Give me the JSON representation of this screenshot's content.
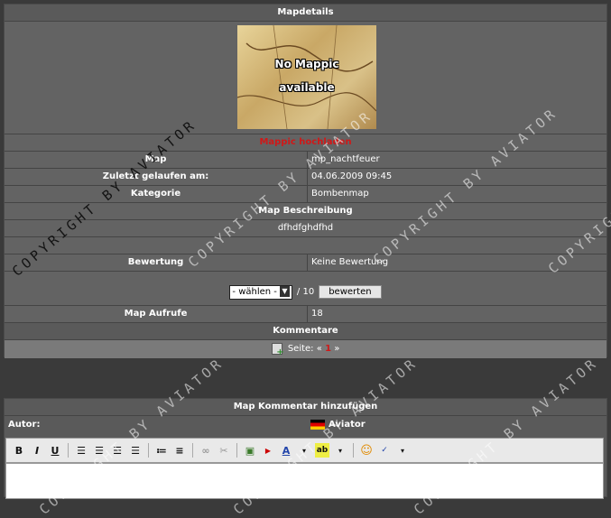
{
  "mapdetails": {
    "header": "Mapdetails",
    "mappic_line1": "No Mappic",
    "mappic_line2": "available",
    "upload_link": "Mappic hochladen",
    "rows": [
      {
        "label": "Map",
        "value": "mp_nachtfeuer"
      },
      {
        "label": "Zuletzt gelaufen am:",
        "value": "04.06.2009 09:45"
      },
      {
        "label": "Kategorie",
        "value": "Bombenmap"
      }
    ],
    "description_header": "Map Beschreibung",
    "description": "dfhdfghdfhd",
    "rating_label": "Bewertung",
    "rating_value": "Keine Bewertung",
    "rating_select": "- wählen -",
    "rating_max": "/ 10",
    "rate_button": "bewerten",
    "views_label": "Map Aufrufe",
    "views_value": "18",
    "comments_header": "Kommentare",
    "page_label": "Seite:",
    "page_prev": "«",
    "page_current": "1",
    "page_next": "»"
  },
  "comment_form": {
    "header": "Map Kommentar hinzufügen",
    "author_label": "Autor:",
    "author_name": "Aviator"
  },
  "toolbar": {
    "bold": "B",
    "italic": "I",
    "underline": "U"
  },
  "watermark": "COPYRIGHT BY AVIATOR",
  "colors": {
    "accent_red": "#d01818",
    "panel": "#636363",
    "background": "#3a3a3a"
  }
}
